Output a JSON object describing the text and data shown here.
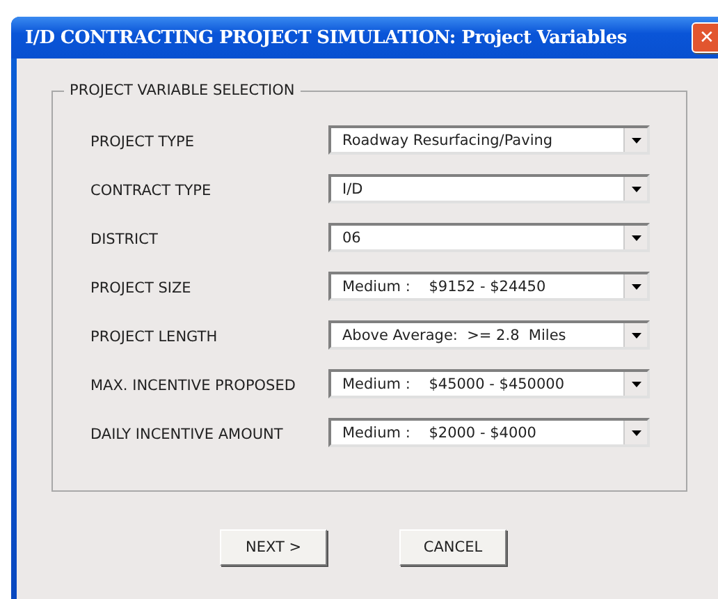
{
  "window": {
    "title": "I/D CONTRACTING PROJECT SIMULATION: Project Variables",
    "close_glyph": "✕"
  },
  "group": {
    "title": "PROJECT VARIABLE SELECTION",
    "fields": [
      {
        "label": "PROJECT TYPE",
        "value": "Roadway Resurfacing/Paving"
      },
      {
        "label": "CONTRACT TYPE",
        "value": "I/D"
      },
      {
        "label": "DISTRICT",
        "value": "06"
      },
      {
        "label": "PROJECT SIZE",
        "value": "Medium :    $9152 - $24450"
      },
      {
        "label": "PROJECT LENGTH",
        "value": "Above Average:  >= 2.8  Miles"
      },
      {
        "label": "MAX. INCENTIVE PROPOSED",
        "value": "Medium :    $45000 - $450000"
      },
      {
        "label": "DAILY INCENTIVE AMOUNT",
        "value": "Medium :    $2000 - $4000"
      }
    ]
  },
  "buttons": [
    "NEXT >",
    "CANCEL"
  ]
}
